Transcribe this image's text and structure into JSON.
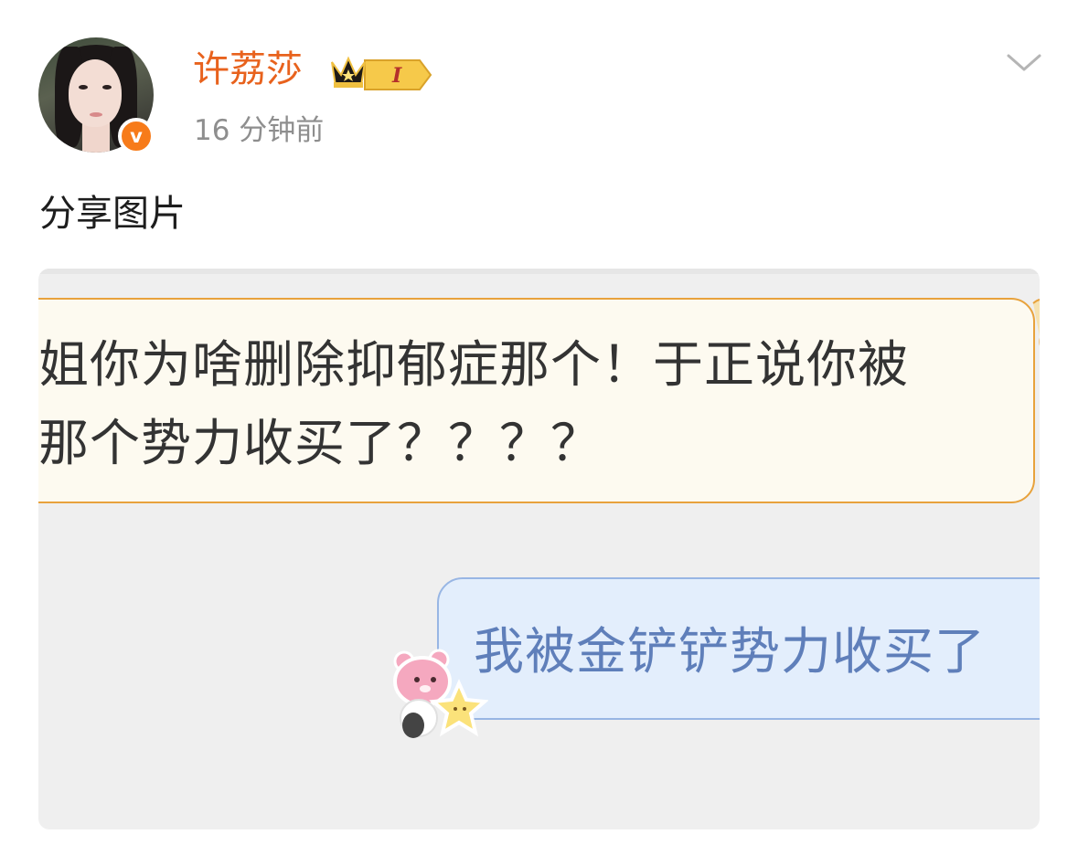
{
  "post": {
    "username": "许荔莎",
    "verified_mark": "v",
    "level_badge": "I",
    "timestamp": "16 分钟前",
    "text": "分享图片"
  },
  "image": {
    "incoming_message": "姐你为啥删除抑郁症那个！于正说你被\n那个势力收买了？？？？",
    "outgoing_message": "我被金铲铲势力收买了"
  },
  "icons": {
    "avatar": "avatar",
    "verified": "verified-badge-icon",
    "level": "crown-level-badge-icon",
    "menu": "chevron-down-icon",
    "sticker": "bear-star-sticker"
  },
  "colors": {
    "username": "#e8621d",
    "verified": "#f77b1a",
    "incoming_bubble_border": "#e8a23c",
    "outgoing_bubble_border": "#98b6e4",
    "outgoing_text": "#5f7fba"
  }
}
